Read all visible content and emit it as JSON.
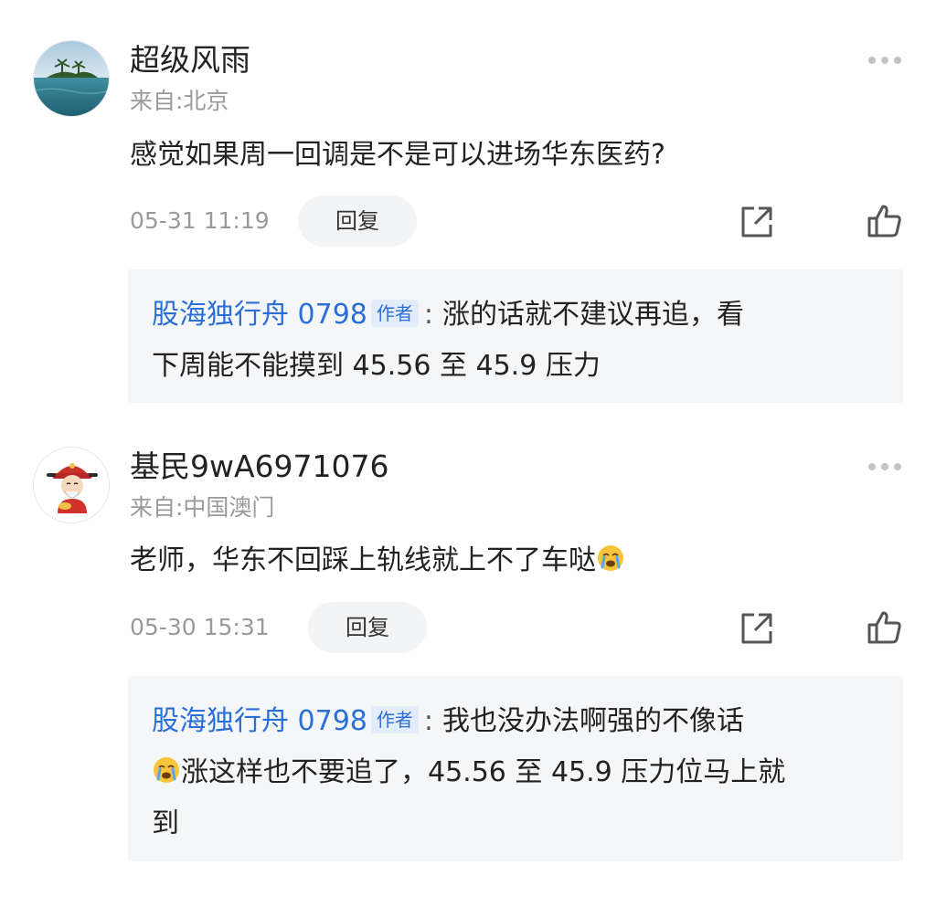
{
  "comments": [
    {
      "username": "超级风雨",
      "location": "来自:北京",
      "text": "感觉如果周一回调是不是可以进场华东医药?",
      "time": "05-31 11:19",
      "reply_label": "回复",
      "avatar": "island-photo",
      "reply": {
        "author": "股海独行舟 0798",
        "tag": "作者",
        "separator": ":",
        "line1": "涨的话就不建议再追，看",
        "line2": "下周能不能摸到 45.56 至 45.9 压力"
      }
    },
    {
      "username": "基民9wA6971076",
      "location": "来自:中国澳门",
      "text": "老师，华东不回踩上轨线就上不了车哒",
      "text_emoji": "crying-face",
      "time": "05-30 15:31",
      "reply_label": "回复",
      "avatar": "god-of-wealth-cartoon",
      "reply": {
        "author": "股海独行舟 0798",
        "tag": "作者",
        "separator": ":",
        "line1": "我也没办法啊强的不像话",
        "line2_emoji": "crying-face",
        "line2": "涨这样也不要追了，45.56 至 45.9 压力位马上就",
        "line3": "到"
      }
    }
  ],
  "icons": {
    "more": "more-dots-icon",
    "share": "share-icon",
    "like": "thumbs-up-icon"
  },
  "colors": {
    "author_link": "#2a6fd8",
    "secondary_text": "#9a9a9a",
    "reply_bg": "#f5f6f8"
  }
}
